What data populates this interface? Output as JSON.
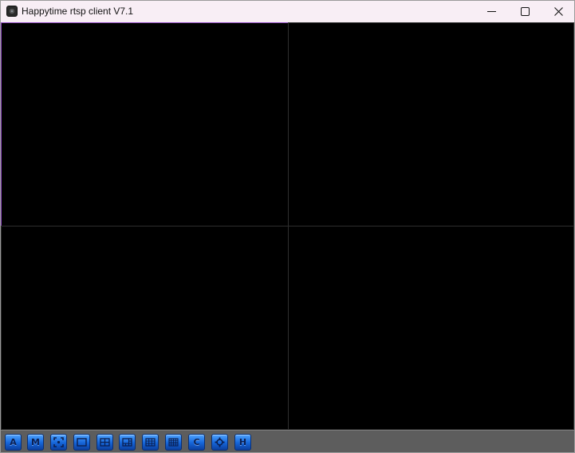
{
  "window": {
    "title": "Happytime rtsp client V7.1",
    "icon": "camera-app-icon"
  },
  "titlebar_controls": {
    "minimize": "minimize-icon",
    "maximize": "maximize-icon",
    "close": "close-icon"
  },
  "video": {
    "layout": "2x2",
    "selected_pane": 1,
    "selected_color": "#8e4ac0"
  },
  "toolbar": {
    "background": "#5d5d5d",
    "accent": "#1565d8",
    "buttons": [
      {
        "name": "btn-a",
        "glyph": "A",
        "icon": "letter-a-icon"
      },
      {
        "name": "btn-m",
        "glyph": "M",
        "icon": "letter-m-icon"
      },
      {
        "name": "btn-fullscreen",
        "glyph": "",
        "icon": "fullscreen-icon"
      },
      {
        "name": "btn-layout-1",
        "glyph": "",
        "icon": "layout-1x1-icon"
      },
      {
        "name": "btn-layout-4",
        "glyph": "",
        "icon": "layout-2x2-icon"
      },
      {
        "name": "btn-layout-6",
        "glyph": "",
        "icon": "layout-1plus5-icon"
      },
      {
        "name": "btn-layout-9",
        "glyph": "",
        "icon": "layout-3x3-icon"
      },
      {
        "name": "btn-layout-16",
        "glyph": "",
        "icon": "layout-4x4-icon"
      },
      {
        "name": "btn-c",
        "glyph": "C",
        "icon": "letter-c-icon"
      },
      {
        "name": "btn-settings",
        "glyph": "",
        "icon": "gear-icon"
      },
      {
        "name": "btn-h",
        "glyph": "H",
        "icon": "letter-h-icon"
      }
    ]
  }
}
